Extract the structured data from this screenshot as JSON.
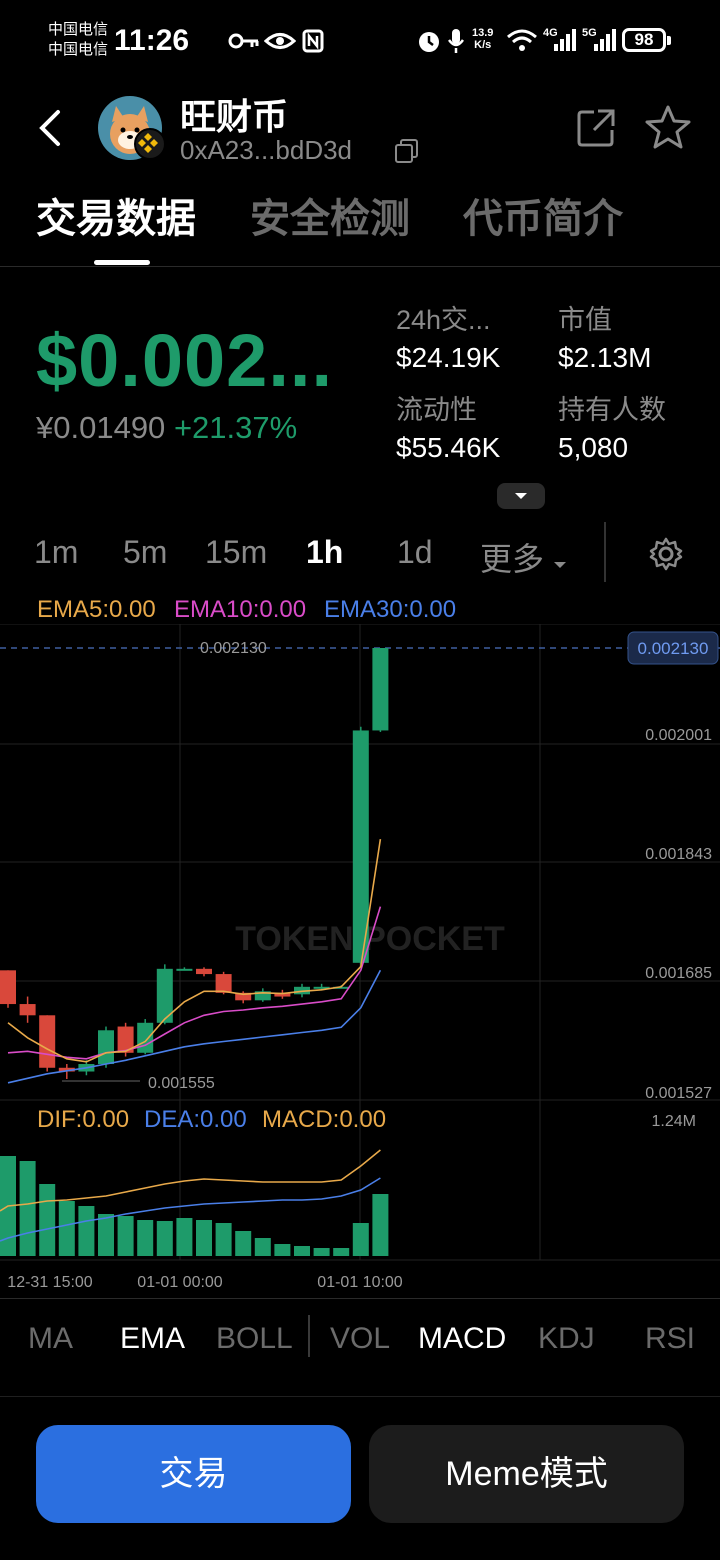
{
  "status_bar": {
    "carrier1": "中国电信",
    "carrier2": "中国电信",
    "time": "11:26",
    "net_speed_value": "13.9",
    "net_speed_unit": "K/s",
    "net1": "4G",
    "net2": "5G",
    "battery": "98"
  },
  "header": {
    "title": "旺财币",
    "address": "0xA23...bdD3d"
  },
  "tabs": [
    "交易数据",
    "安全检测",
    "代币简介"
  ],
  "price": {
    "usd": "$0.002...",
    "cny": "¥0.01490",
    "change": "+21.37%"
  },
  "stats": {
    "volume_label": "24h交...",
    "volume": "$24.19K",
    "mcap_label": "市值",
    "mcap": "$2.13M",
    "liquidity_label": "流动性",
    "liquidity": "$55.46K",
    "holders_label": "持有人数",
    "holders": "5,080"
  },
  "intervals": [
    "1m",
    "5m",
    "15m",
    "1h",
    "1d",
    "更多"
  ],
  "ema_legend": {
    "ema5": "EMA5:0.00",
    "ema10": "EMA10:0.00",
    "ema30": "EMA30:0.00"
  },
  "macd_legend": {
    "dif": "DIF:0.00",
    "dea": "DEA:0.00",
    "macd": "MACD:0.00"
  },
  "chart_data": {
    "type": "candlestick",
    "price_axis": [
      "0.002001",
      "0.001843",
      "0.001685",
      "0.001527"
    ],
    "current_price": "0.002130",
    "high_label": "0.002130",
    "low_label": "0.001555",
    "volume_max": "1.24M",
    "x_ticks": [
      "12-31 15:00",
      "01-01 00:00",
      "01-01 10:00"
    ],
    "watermark": "TOKEN POCKET",
    "colors": {
      "up": "#1e9b6a",
      "down": "#d9483b",
      "ema5": "#e8a94a",
      "ema10": "#d94cc8",
      "ema30": "#4a7fe8"
    },
    "candles": [
      {
        "o": 0.0017,
        "c": 0.001655,
        "h": 0.0017,
        "l": 0.00165
      },
      {
        "o": 0.001655,
        "c": 0.00164,
        "h": 0.001665,
        "l": 0.00163
      },
      {
        "o": 0.00164,
        "c": 0.00157,
        "h": 0.00164,
        "l": 0.001565
      },
      {
        "o": 0.00157,
        "c": 0.001565,
        "h": 0.001575,
        "l": 0.001555
      },
      {
        "o": 0.001565,
        "c": 0.001575,
        "h": 0.00158,
        "l": 0.00156
      },
      {
        "o": 0.001575,
        "c": 0.00162,
        "h": 0.001625,
        "l": 0.00157
      },
      {
        "o": 0.001625,
        "c": 0.00159,
        "h": 0.00163,
        "l": 0.001585
      },
      {
        "o": 0.00159,
        "c": 0.00163,
        "h": 0.001635,
        "l": 0.001588
      },
      {
        "o": 0.00163,
        "c": 0.001702,
        "h": 0.001708,
        "l": 0.001628
      },
      {
        "o": 0.001702,
        "c": 0.001702,
        "h": 0.001704,
        "l": 0.0017
      },
      {
        "o": 0.001702,
        "c": 0.001695,
        "h": 0.001704,
        "l": 0.001692
      },
      {
        "o": 0.001695,
        "c": 0.00167,
        "h": 0.001698,
        "l": 0.001668
      },
      {
        "o": 0.00167,
        "c": 0.00166,
        "h": 0.001672,
        "l": 0.001656
      },
      {
        "o": 0.00166,
        "c": 0.001672,
        "h": 0.001676,
        "l": 0.001658
      },
      {
        "o": 0.00167,
        "c": 0.001665,
        "h": 0.001674,
        "l": 0.001662
      },
      {
        "o": 0.001668,
        "c": 0.001678,
        "h": 0.001682,
        "l": 0.001664
      },
      {
        "o": 0.001678,
        "c": 0.001678,
        "h": 0.001682,
        "l": 0.001674
      },
      {
        "o": 0.001678,
        "c": 0.001678,
        "h": 0.00168,
        "l": 0.001676
      },
      {
        "o": 0.00171,
        "c": 0.00202,
        "h": 0.002025,
        "l": 0.001708
      },
      {
        "o": 0.00202,
        "c": 0.00213,
        "h": 0.00213,
        "l": 0.002018
      }
    ],
    "ema5": [
      0.00163,
      0.00161,
      0.001595,
      0.001582,
      0.001578,
      0.00159,
      0.001592,
      0.001605,
      0.001635,
      0.001658,
      0.001672,
      0.001672,
      0.001668,
      0.00167,
      0.001669,
      0.001672,
      0.001674,
      0.001678,
      0.001705,
      0.001875
    ],
    "ema10": [
      0.00159,
      0.001592,
      0.001588,
      0.001584,
      0.001582,
      0.00159,
      0.001593,
      0.0016,
      0.001615,
      0.00163,
      0.00164,
      0.001645,
      0.001647,
      0.00165,
      0.001652,
      0.001655,
      0.001658,
      0.001662,
      0.0017,
      0.001785
    ],
    "ema30": [
      0.00155,
      0.001556,
      0.001562,
      0.001566,
      0.00157,
      0.001575,
      0.00158,
      0.001586,
      0.001592,
      0.001598,
      0.001602,
      0.001605,
      0.001608,
      0.001611,
      0.001614,
      0.001617,
      0.00162,
      0.001624,
      0.00165,
      0.0017
    ],
    "macd_bars": [
      1.0,
      0.95,
      0.72,
      0.55,
      0.5,
      0.42,
      0.4,
      0.36,
      0.35,
      0.38,
      0.36,
      0.33,
      0.25,
      0.18,
      0.12,
      0.1,
      0.08,
      0.08,
      0.33,
      0.62
    ],
    "dif": [
      0.5,
      0.52,
      0.55,
      0.56,
      0.58,
      0.6,
      0.64,
      0.68,
      0.72,
      0.75,
      0.77,
      0.76,
      0.75,
      0.74,
      0.74,
      0.74,
      0.74,
      0.76,
      0.9,
      1.06
    ],
    "dea": [
      0.18,
      0.23,
      0.27,
      0.31,
      0.35,
      0.38,
      0.42,
      0.45,
      0.48,
      0.5,
      0.52,
      0.53,
      0.54,
      0.55,
      0.56,
      0.56,
      0.57,
      0.6,
      0.66,
      0.78
    ]
  },
  "indicators": [
    "MA",
    "EMA",
    "BOLL",
    "VOL",
    "MACD",
    "KDJ",
    "RSI"
  ],
  "buttons": {
    "trade": "交易",
    "meme": "Meme模式"
  }
}
